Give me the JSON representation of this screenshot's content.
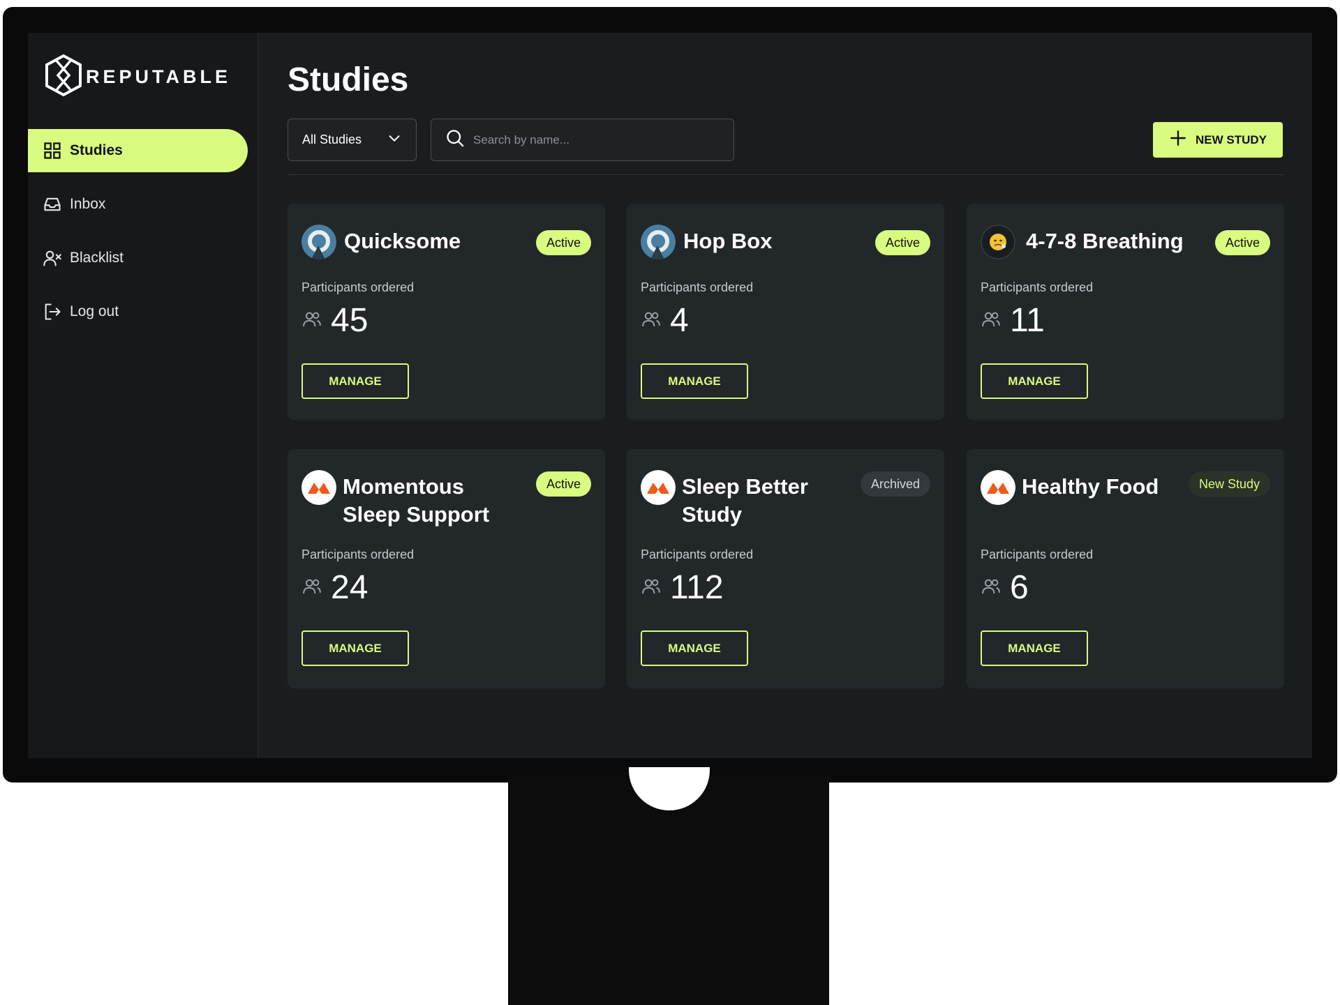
{
  "brand": {
    "name": "REPUTABLE"
  },
  "sidebar": {
    "items": [
      {
        "label": "Studies",
        "icon": "grid-icon",
        "active": true
      },
      {
        "label": "Inbox",
        "icon": "inbox-icon",
        "active": false
      },
      {
        "label": "Blacklist",
        "icon": "user-x-icon",
        "active": false
      },
      {
        "label": "Log out",
        "icon": "logout-icon",
        "active": false
      }
    ]
  },
  "header": {
    "title": "Studies",
    "filter": {
      "selected": "All Studies"
    },
    "search": {
      "placeholder": "Search by name..."
    },
    "new_study_label": "NEW STUDY"
  },
  "studies": [
    {
      "name": "Quicksome",
      "status": "Active",
      "participants_label": "Participants ordered",
      "participants": "45",
      "manage_label": "MANAGE"
    },
    {
      "name": "Hop Box",
      "status": "Active",
      "participants_label": "Participants ordered",
      "participants": "4",
      "manage_label": "MANAGE"
    },
    {
      "name": "4-7-8 Breathing",
      "status": "Active",
      "participants_label": "Participants ordered",
      "participants": "11",
      "manage_label": "MANAGE"
    },
    {
      "name": "Momentous Sleep Support",
      "status": "Active",
      "participants_label": "Participants ordered",
      "participants": "24",
      "manage_label": "MANAGE"
    },
    {
      "name": "Sleep Better Study",
      "status": "Archived",
      "participants_label": "Participants ordered",
      "participants": "112",
      "manage_label": "MANAGE"
    },
    {
      "name": "Healthy Food",
      "status": "New Study",
      "participants_label": "Participants ordered",
      "participants": "6",
      "manage_label": "MANAGE"
    }
  ],
  "colors": {
    "accent": "#d9fb7f",
    "background": "#1a1d1f",
    "sidebar": "#16181a",
    "card": "#22272a"
  }
}
